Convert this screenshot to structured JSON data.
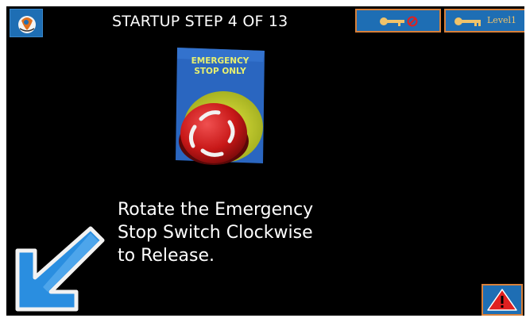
{
  "header": {
    "step_title": "STARTUP STEP 4 OF 13",
    "logo_icon": "home-logo-icon",
    "lock_icon": "key-lock-icon",
    "level_icon": "key-icon",
    "level_label": "Level1"
  },
  "estop_photo": {
    "label_line1": "EMERGENCY",
    "label_line2": "STOP ONLY"
  },
  "instruction": {
    "line1": "Rotate the Emergency",
    "line2": "Stop Switch Clockwise",
    "line3": "to Release."
  },
  "navigation": {
    "back_icon": "arrow-down-left-icon"
  },
  "alarm": {
    "icon": "warning-triangle-icon"
  },
  "colors": {
    "screen_background": "#000000",
    "button_blue": "#1e6eb4",
    "button_border": "#d8803a",
    "alarm_red": "#e02020",
    "arrow_blue": "#2a8ee0"
  }
}
